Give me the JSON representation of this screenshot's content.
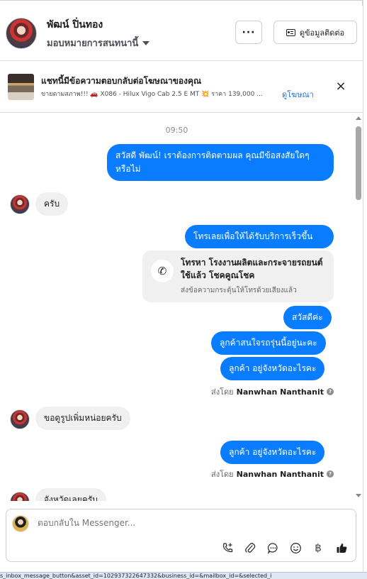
{
  "header": {
    "contact_name": "พัฒน์ ปิ่นทอง",
    "assign_label": "มอบหมายการสนทนานี้",
    "more_label": "···",
    "view_contact_label": "ดูข้อมูลติดต่อ"
  },
  "ad": {
    "title": "แชทนี้มีข้อความตอบกลับต่อโฆษณาของคุณ",
    "subtitle": "ขายตามสภาพ!!! 🚗 X086 - Hilux Vigo Cab 2.5 E MT 💥 ราคา 139,000 ...",
    "link_label": "ดูโฆษณา",
    "close_label": "×"
  },
  "chat": {
    "timestamp": "09:50",
    "msg_greeting": "สวัสดี พัฒน์! เราต้องการติดตามผล คุณมีข้อสงสัยใดๆ หรือไม่",
    "msg_reply_1": "ครับ",
    "msg_call_prompt": "โทรเลยเพื่อให้ได้รับบริการเร็วขึ้น",
    "call_card": {
      "title": "โทรหา โรงงานผลิตและกระจายรถยนต์ใช้แล้ว โชคคูณโชค",
      "subtitle": "ส่งข้อความกระตุ้นให้โทรด้วยเสียงแล้ว"
    },
    "msg_hello": "สวัสดีค่ะ",
    "msg_interest": "ลูกค้าสนใจรถรุ่นนี้อยู่นะคะ",
    "msg_province_1": "ลูกค้า อยู่จังหวัดอะไรคะ",
    "sent_by_prefix": "ส่งโดย",
    "sent_by_name": "Nanwhan Nanthanit",
    "msg_more_photos": "ขอดูรูปเพิ่มหน่อยครับ",
    "msg_province_2": "ลูกค้า อยู่จังหวัดอะไรคะ",
    "msg_partial": "จังหวัดเลยครับ"
  },
  "composer": {
    "placeholder": "ตอบกลับใน Messenger..."
  },
  "status_bar": {
    "text": "s_inbox_message_button&asset_id=102937322647332&business_id=&mailbox_id=&selected_i"
  }
}
